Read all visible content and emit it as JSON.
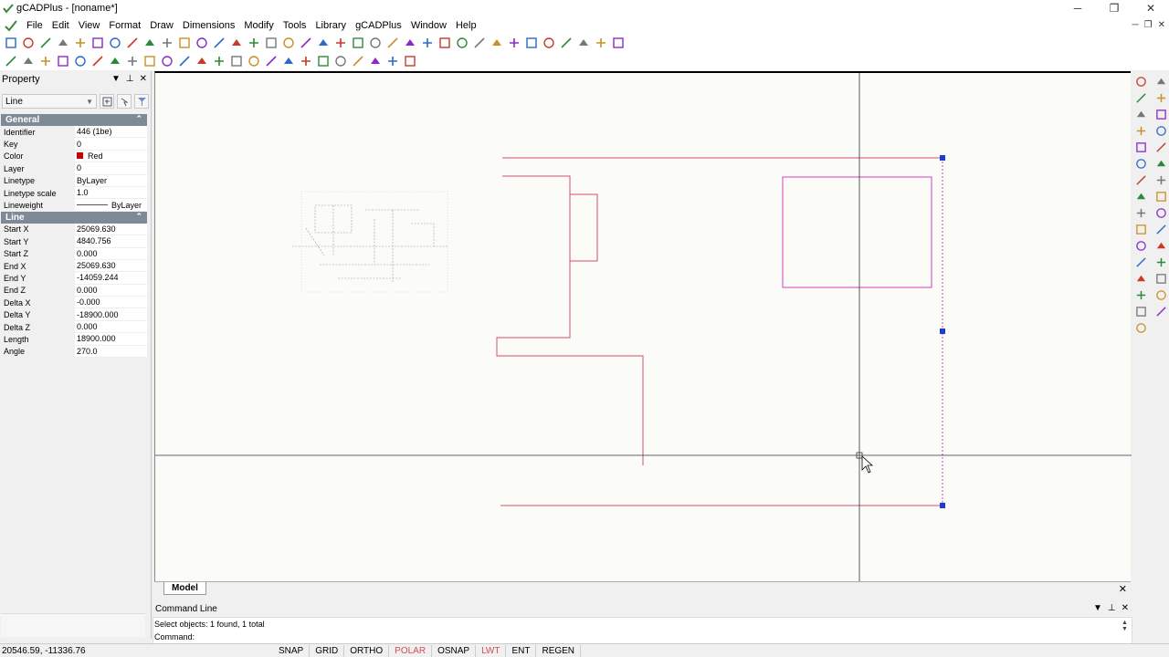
{
  "window": {
    "title": "gCADPlus - [noname*]",
    "minimize_glyph": "─",
    "restore_glyph": "❐",
    "close_glyph": "✕"
  },
  "menu": {
    "items": [
      "File",
      "Edit",
      "View",
      "Format",
      "Draw",
      "Dimensions",
      "Modify",
      "Tools",
      "Library",
      "gCADPlus",
      "Window",
      "Help"
    ]
  },
  "property_panel": {
    "title": "Property",
    "selected_type": "Line",
    "sections": [
      {
        "title": "General",
        "rows": [
          {
            "key": "Identifier",
            "value": "446 (1be)"
          },
          {
            "key": "Key",
            "value": "0"
          },
          {
            "key": "Color",
            "value": "Red",
            "swatch": "#cc0000"
          },
          {
            "key": "Layer",
            "value": "0"
          },
          {
            "key": "Linetype",
            "value": "ByLayer"
          },
          {
            "key": "Linetype scale",
            "value": "1.0"
          },
          {
            "key": "Lineweight",
            "value": "ByLayer",
            "lineweight": true
          }
        ]
      },
      {
        "title": "Line",
        "rows": [
          {
            "key": "Start X",
            "value": "25069.630"
          },
          {
            "key": "Start Y",
            "value": "4840.756"
          },
          {
            "key": "Start Z",
            "value": "0.000"
          },
          {
            "key": "End X",
            "value": "25069.630"
          },
          {
            "key": "End Y",
            "value": "-14059.244"
          },
          {
            "key": "End Z",
            "value": "0.000"
          },
          {
            "key": "Delta X",
            "value": "-0.000"
          },
          {
            "key": "Delta Y",
            "value": "-18900.000"
          },
          {
            "key": "Delta Z",
            "value": "0.000"
          },
          {
            "key": "Length",
            "value": "18900.000"
          },
          {
            "key": "Angle",
            "value": "270.0"
          }
        ]
      }
    ]
  },
  "tabs": {
    "model": "Model",
    "close_glyph": "✕"
  },
  "command_line": {
    "title": "Command Line",
    "history": "Select objects: 1 found,  1 total",
    "prompt": "Command:"
  },
  "status": {
    "coords": "20546.59, -11336.76",
    "buttons": [
      {
        "label": "SNAP",
        "on": false
      },
      {
        "label": "GRID",
        "on": false
      },
      {
        "label": "ORTHO",
        "on": false
      },
      {
        "label": "POLAR",
        "on": true
      },
      {
        "label": "OSNAP",
        "on": false
      },
      {
        "label": "LWT",
        "on": true
      },
      {
        "label": "ENT",
        "on": false
      },
      {
        "label": "REGEN",
        "on": false
      }
    ]
  },
  "colors": {
    "entity_red": "#d0506a",
    "entity_magenta": "#d040c0",
    "grip_blue": "#1a3fd0",
    "section_header": "#7e8a96"
  }
}
